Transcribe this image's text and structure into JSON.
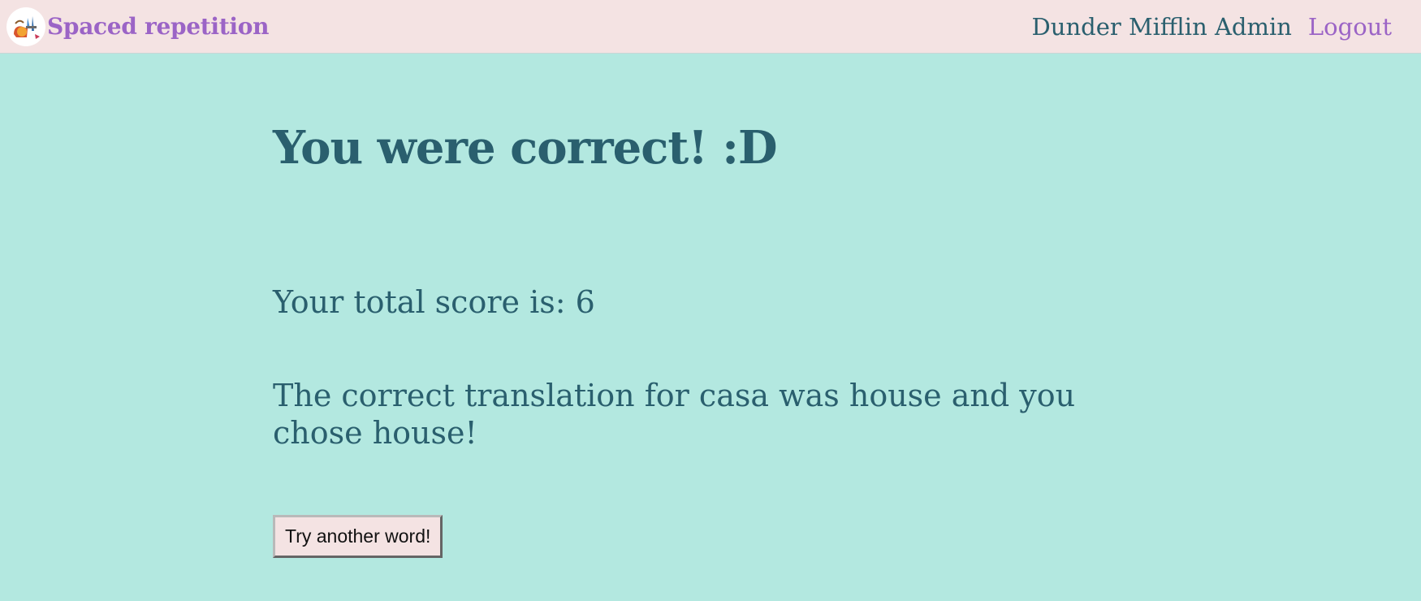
{
  "header": {
    "brand_title": "Spaced repetition",
    "username": "Dunder Mifflin Admin",
    "logout_label": "Logout",
    "logo_icon": "language-tools-icon"
  },
  "main": {
    "heading": "You were correct! :D",
    "score_text": "Your total score is: 6",
    "translation_text": "The correct translation for casa was house and you chose house!",
    "next_button_label": "Try another word!"
  },
  "colors": {
    "background": "#b3e8e0",
    "header_background": "#f4e3e3",
    "brand_purple": "#9b64c6",
    "text_teal": "#2a5f6e"
  }
}
